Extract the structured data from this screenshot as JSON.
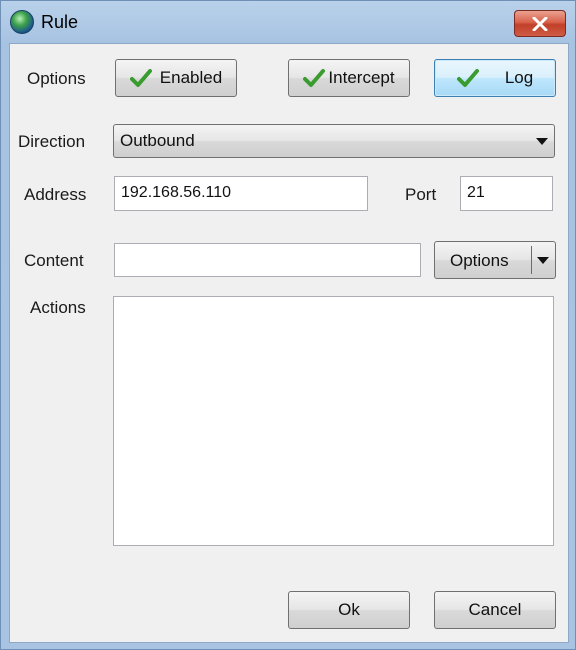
{
  "window": {
    "title": "Rule",
    "close_icon": "close-x-icon"
  },
  "options": {
    "label": "Options",
    "buttons": [
      {
        "label": "Enabled",
        "checked": true
      },
      {
        "label": "Intercept",
        "checked": true
      },
      {
        "label": "Log",
        "checked": true,
        "active": true
      }
    ]
  },
  "direction": {
    "label": "Direction",
    "value": "Outbound"
  },
  "address": {
    "label": "Address",
    "value": "192.168.56.110"
  },
  "port": {
    "label": "Port",
    "value": "21"
  },
  "content": {
    "label": "Content",
    "value": "",
    "options_label": "Options"
  },
  "actions": {
    "label": "Actions",
    "value": ""
  },
  "footer": {
    "ok_label": "Ok",
    "cancel_label": "Cancel"
  },
  "colors": {
    "check": "#3a9b2e",
    "accent": "#3c7fb1",
    "close": "#c2412a"
  }
}
